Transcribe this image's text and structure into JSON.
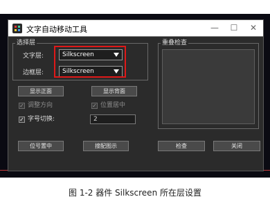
{
  "window": {
    "title": "文字自动移动工具",
    "controls": [
      "—",
      "☐",
      "✕"
    ]
  },
  "selection_group": {
    "label": "选择层",
    "text_layer": {
      "label": "文字层:",
      "value": "Silkscreen"
    },
    "border_layer": {
      "label": "边框层:",
      "value": "Silkscreen"
    }
  },
  "preview_group": {
    "label": "重叠检查"
  },
  "buttons": {
    "show_front": "显示正面",
    "show_back": "显示背面",
    "position_center": "位号置中",
    "batch_display": "搜配图示",
    "check": "检查",
    "close": "关闭"
  },
  "options": {
    "adjust_direction": {
      "label": "调整方向",
      "checked": true,
      "enabled": false
    },
    "position_center": {
      "label": "位置居中",
      "checked": true,
      "enabled": false
    },
    "font_switch": {
      "label": "字号切换:",
      "checked": true,
      "enabled": true,
      "value": "2"
    }
  },
  "caption": "图 1-2 器件 Silkscreen 所在层设置",
  "colors": {
    "highlight": "#e01818",
    "dialog_bg": "#2b2b2b"
  }
}
